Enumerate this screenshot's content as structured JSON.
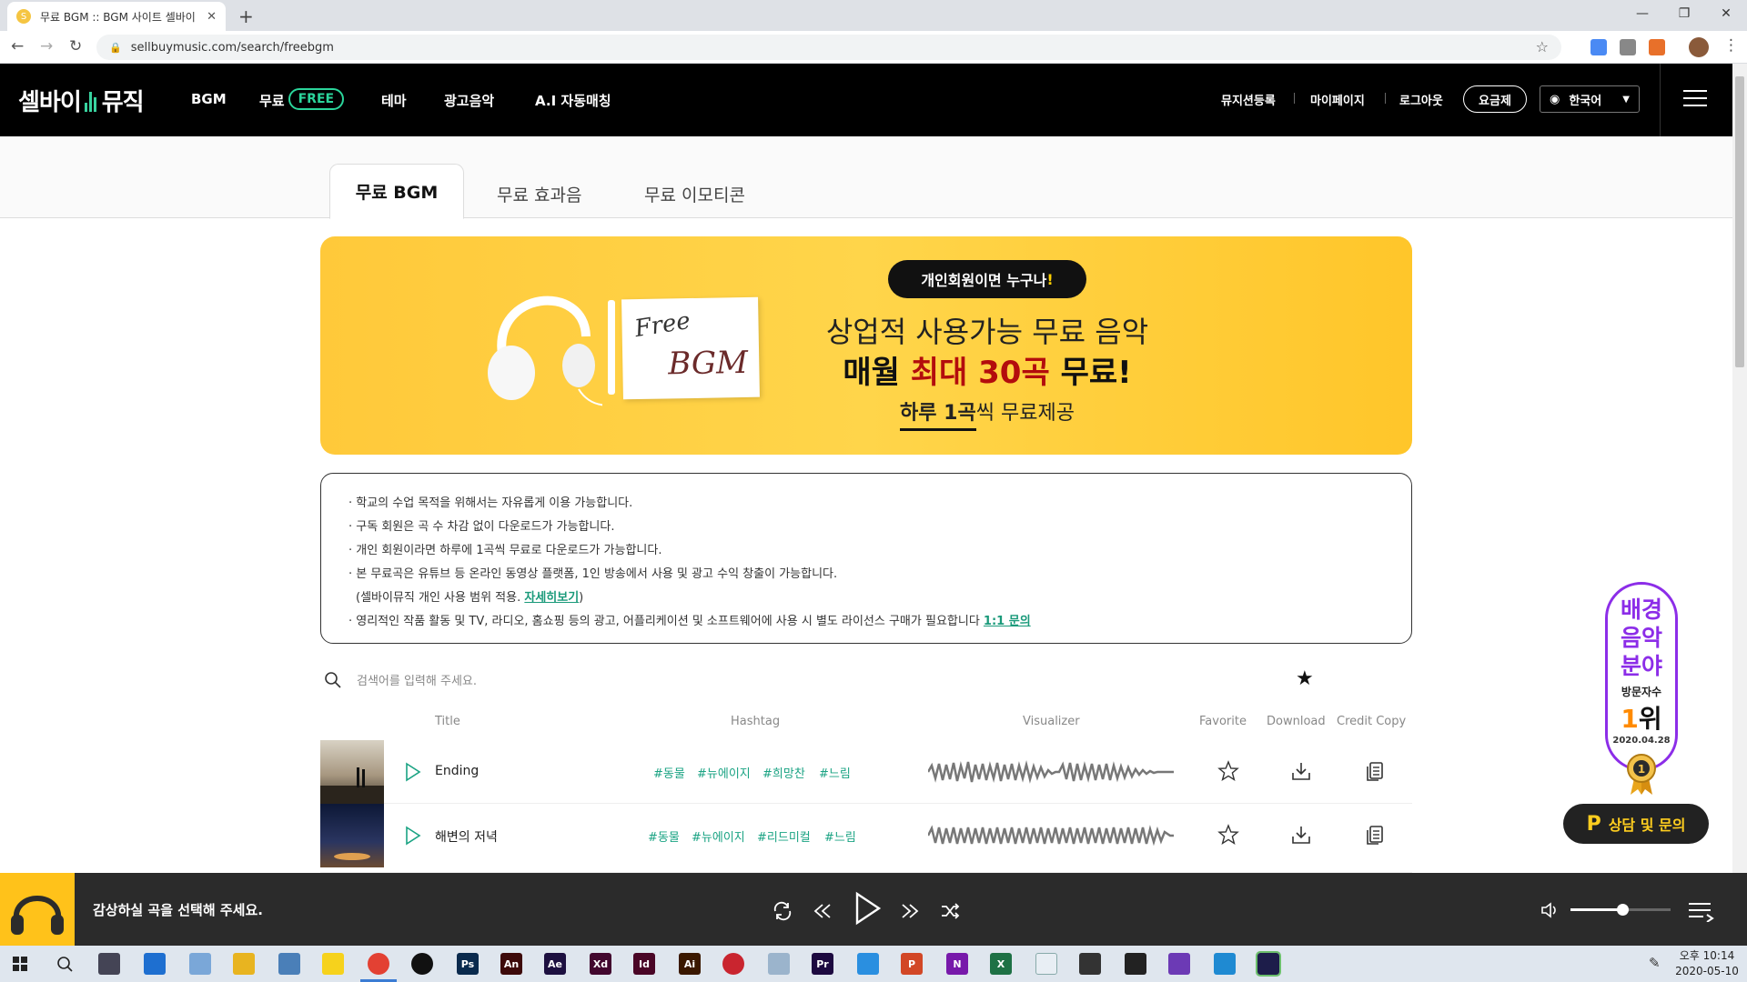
{
  "browser": {
    "tab_title": "무료 BGM :: BGM 사이트 셀바이",
    "tab_favicon": "S",
    "url": "sellbuymusic.com/search/freebgm"
  },
  "header": {
    "logo_left": "셀바이",
    "logo_right": "뮤직",
    "nav": {
      "bgm": "BGM",
      "free_prefix": "무료",
      "free_pill": "FREE",
      "theme": "테마",
      "ad_music": "광고음악",
      "ai": "A.I 자동매칭"
    },
    "musician_register": "뮤지션등록",
    "mypage": "마이페이지",
    "logout": "로그아웃",
    "pricing": "요금제",
    "language": "한국어"
  },
  "subtabs": [
    "무료 BGM",
    "무료 효과음",
    "무료 이모티콘"
  ],
  "banner": {
    "card_word1": "Free",
    "card_word2": "BGM",
    "pill_text": "개인회원이면 누구나",
    "pill_mark": "!",
    "line1": "상업적 사용가능 무료 음악",
    "line2_pre": "매월 ",
    "line2_highlight": "최대 30곡",
    "line2_post": " 무료!",
    "line3_bold": "하루 1곡",
    "line3_rest": "씩 무료제공"
  },
  "notice": {
    "line1": "· 학교의 수업 목적을 위해서는 자유롭게 이용 가능합니다.",
    "line2": "· 구독 회원은 곡 수 차감 없이 다운로드가 가능합니다.",
    "line3": "· 개인 회원이라면 하루에 1곡씩 무료로 다운로드가 가능합니다.",
    "line4": "· 본 무료곡은 유튜브 등 온라인 동영상 플랫폼, 1인 방송에서 사용 및 광고 수익 창출이 가능합니다.",
    "line5_pre": "(셀바이뮤직 개인 사용 범위 적용. ",
    "line5_link": "자세히보기",
    "line5_post": ")",
    "line6_pre": "· 영리적인 작품 활동 및 TV, 라디오, 홈쇼핑 등의 광고, 어플리케이션 및 소프트웨어에 사용 시 별도 라이선스 구매가 필요합니다 ",
    "line6_link": "1:1 문의"
  },
  "search": {
    "placeholder": "검색어를 입력해 주세요."
  },
  "columns": {
    "title": "Title",
    "hashtag": "Hashtag",
    "visualizer": "Visualizer",
    "favorite": "Favorite",
    "download": "Download",
    "credit": "Credit Copy"
  },
  "tracks": [
    {
      "title": "Ending",
      "tags": [
        "#동물",
        "#뉴에이지",
        "#희망찬",
        "#느림"
      ]
    },
    {
      "title": "해변의 저녁",
      "tags": [
        "#동물",
        "#뉴에이지",
        "#리드미컬",
        "#느림"
      ]
    }
  ],
  "badge": {
    "main1": "배경",
    "main2": "음악",
    "main3": "분야",
    "sub": "방문자수",
    "rank_num": "1",
    "rank_unit": "위",
    "date": "2020.04.28"
  },
  "consult": {
    "mark": "P",
    "label": "상담 및 문의"
  },
  "player": {
    "message": "감상하실 곡을 선택해 주세요.",
    "volume": 0.52
  },
  "taskbar": {
    "time": "오후 10:14",
    "date": "2020-05-10",
    "apps": [
      {
        "label": "Ps",
        "color": "#0a2a4d"
      },
      {
        "label": "An",
        "color": "#3d0a0a"
      },
      {
        "label": "Ae",
        "color": "#1d1040"
      },
      {
        "label": "Xd",
        "color": "#42072e"
      },
      {
        "label": "Id",
        "color": "#4a0626"
      },
      {
        "label": "Ai",
        "color": "#3a1800"
      },
      {
        "label": "Pr",
        "color": "#1d0a40"
      },
      {
        "label": "P",
        "color": "#d24726"
      },
      {
        "label": "N",
        "color": "#7719aa"
      },
      {
        "label": "X",
        "color": "#1e7145"
      }
    ]
  },
  "colors": {
    "accent": "#2bd59b",
    "banner": "#ffc93a",
    "badge": "#8c2de8",
    "highlight_red": "#b30d0d"
  }
}
